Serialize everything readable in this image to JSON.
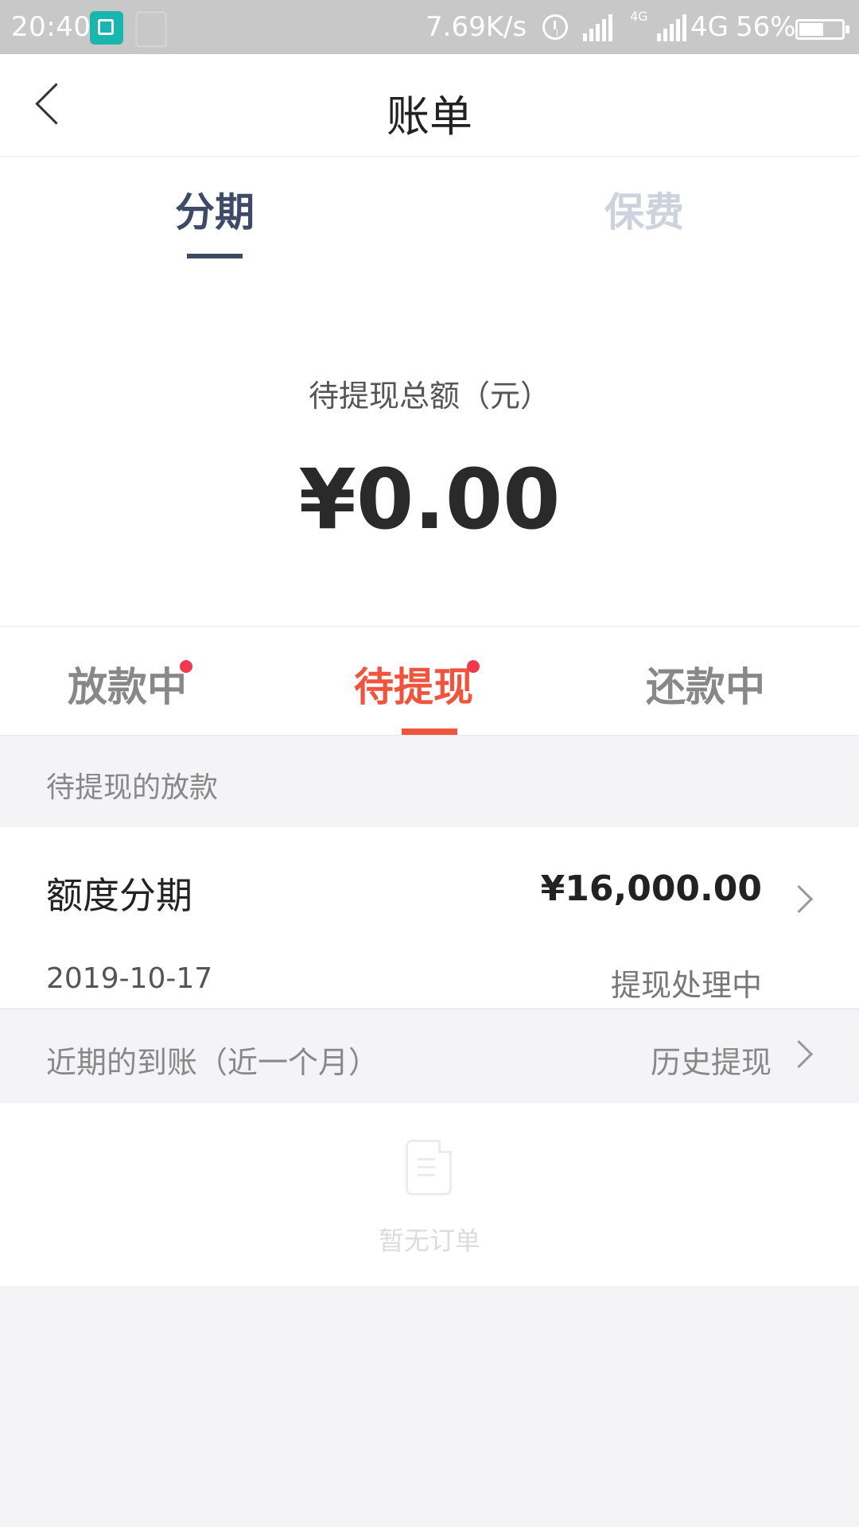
{
  "status_bar": {
    "time": "20:40",
    "speed": "7.69K/s",
    "small_network": "4G",
    "network": "4G",
    "battery": "56%"
  },
  "header": {
    "title": "账单"
  },
  "main_tabs": [
    {
      "label": "分期",
      "active": true
    },
    {
      "label": "保费",
      "active": false
    }
  ],
  "summary": {
    "label": "待提现总额（元）",
    "amount": "¥0.00"
  },
  "sub_tabs": [
    {
      "label": "放款中",
      "has_dot": true,
      "active": false
    },
    {
      "label": "待提现",
      "has_dot": true,
      "active": true
    },
    {
      "label": "还款中",
      "has_dot": false,
      "active": false
    }
  ],
  "pending_section": {
    "title": "待提现的放款"
  },
  "loan_item": {
    "name": "额度分期",
    "amount": "¥16,000.00",
    "date": "2019-10-17",
    "status": "提现处理中"
  },
  "recent_section": {
    "title": "近期的到账（近一个月）",
    "history_label": "历史提现"
  },
  "empty_state": {
    "text": "暂无订单",
    "icon": "document-icon"
  },
  "colors": {
    "accent": "#f0543c",
    "primary_tab": "#3f4a66",
    "dot": "#ef3a4e"
  }
}
